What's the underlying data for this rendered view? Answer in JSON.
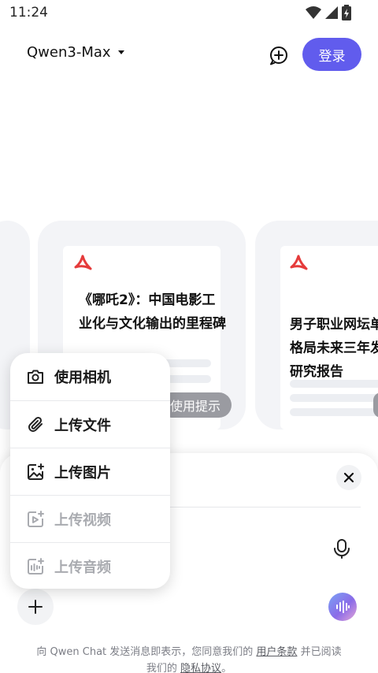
{
  "status_bar": {
    "time": "11:24"
  },
  "header": {
    "model_name": "Qwen3-Max",
    "login_label": "登录"
  },
  "cards": [
    {
      "title": "《哪吒2》：中国电影工业化与文化输出的里程碑"
    },
    {
      "title": "男子职业网坛单格局未来三年发研究报告"
    }
  ],
  "tip_chip": "使用提示",
  "menu": {
    "items": [
      {
        "label": "使用相机",
        "icon": "camera-icon",
        "enabled": true
      },
      {
        "label": "上传文件",
        "icon": "paperclip-icon",
        "enabled": true
      },
      {
        "label": "上传图片",
        "icon": "image-upload-icon",
        "enabled": true
      },
      {
        "label": "上传视频",
        "icon": "video-upload-icon",
        "enabled": false
      },
      {
        "label": "上传音频",
        "icon": "audio-upload-icon",
        "enabled": false
      }
    ]
  },
  "terms": {
    "prefix": "向 Qwen Chat 发送消息即表示，您同意我们的 ",
    "user_terms": "用户条款",
    "middle": " 并已阅读",
    "line2_prefix": "我们的 ",
    "privacy": "隐私协议",
    "suffix": "。"
  },
  "colors": {
    "accent": "#615ced",
    "pdf_red": "#e53b3b"
  }
}
